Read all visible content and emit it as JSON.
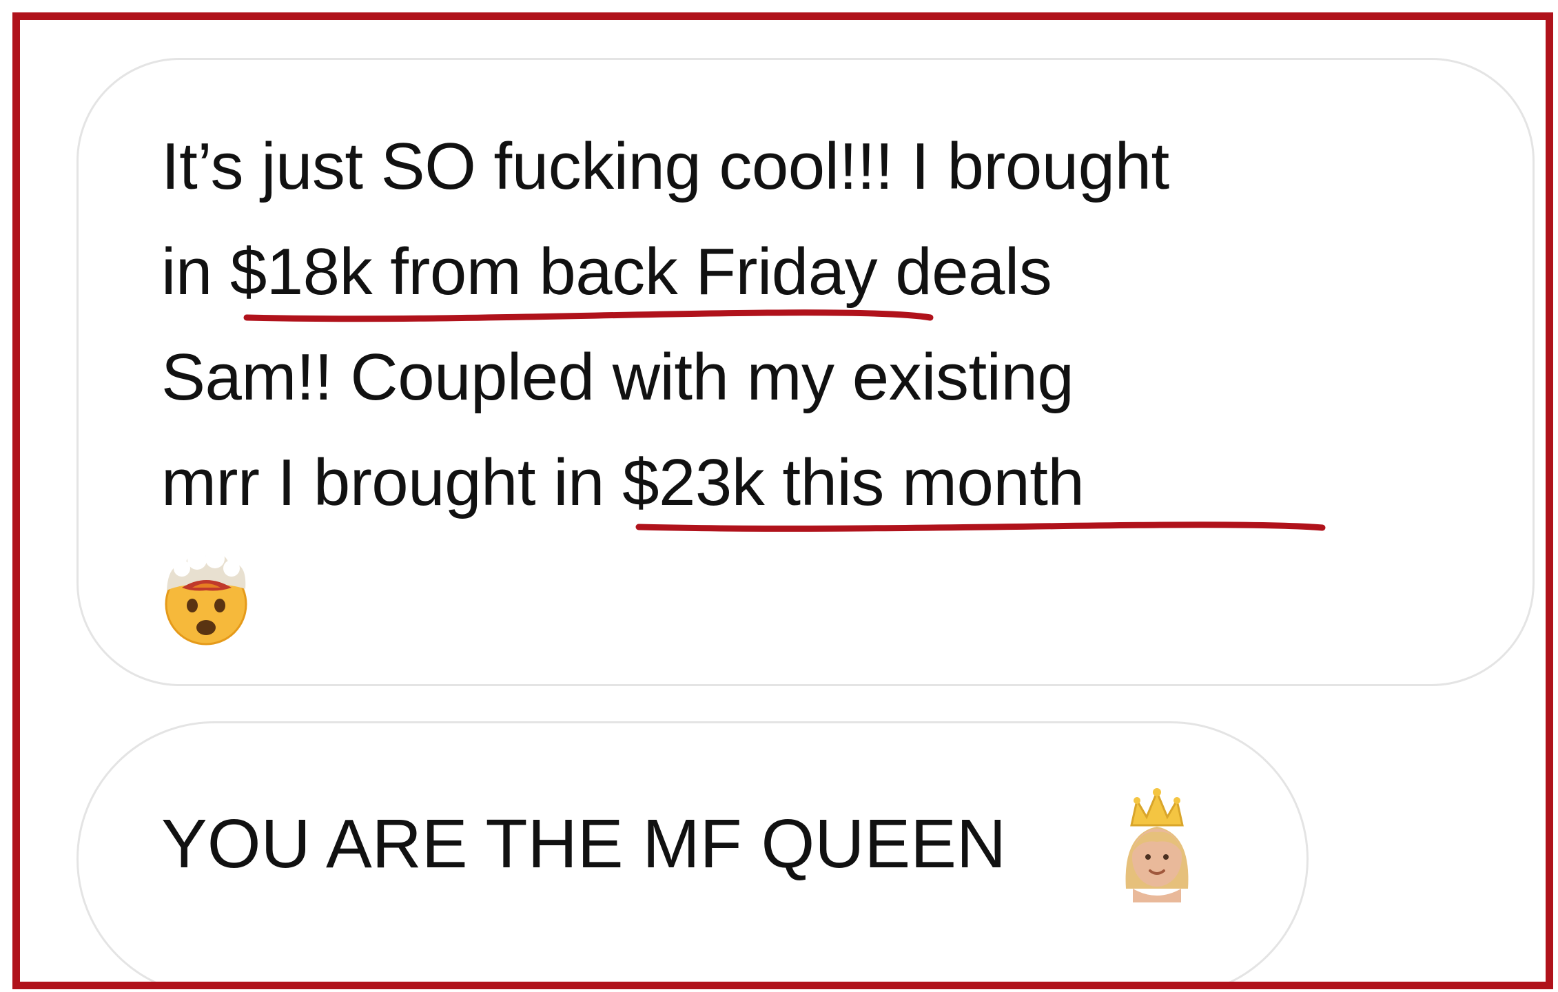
{
  "conversation": {
    "messages": [
      {
        "lines": [
          {
            "text": "It’s just SO fucking cool!!! I brought"
          },
          {
            "pre": "in ",
            "highlight": "$18k from back Friday deals"
          },
          {
            "text": "Sam!! Coupled with my existing"
          },
          {
            "pre": "mrr I brought in ",
            "highlight": "$23k this month"
          }
        ],
        "emoji": "exploding-head-emoji"
      },
      {
        "text": "YOU ARE THE MF QUEEN",
        "emoji": "princess-emoji"
      }
    ]
  },
  "colors": {
    "frame": "#b0121b",
    "underline": "#b0121b",
    "bubble_border": "#e4e4e4",
    "text": "#111111"
  }
}
